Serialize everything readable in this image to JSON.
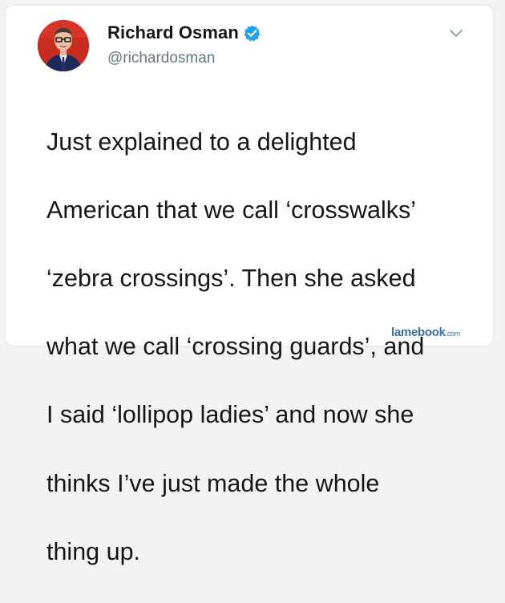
{
  "tweet": {
    "author_name": "Richard Osman",
    "author_handle": "@richardosman",
    "verified": true,
    "text_lines": [
      "Just explained to a delighted",
      "American that we call ‘crosswalks’",
      "‘zebra crossings’. Then she asked",
      "what we call ‘crossing guards’, and",
      "I said ‘lollipop ladies’ and now she",
      "thinks I’ve just made the whole",
      "thing up."
    ]
  },
  "icons": {
    "verified": "verified-badge-icon",
    "menu": "chevron-down-icon",
    "avatar": "profile-photo"
  },
  "colors": {
    "verified_blue": "#1da1f2",
    "text": "#14171a",
    "handle_gray": "#657786",
    "watermark_blue": "#3b6ea5"
  },
  "watermark": {
    "brand": "lamebook",
    "domain": ".com"
  }
}
